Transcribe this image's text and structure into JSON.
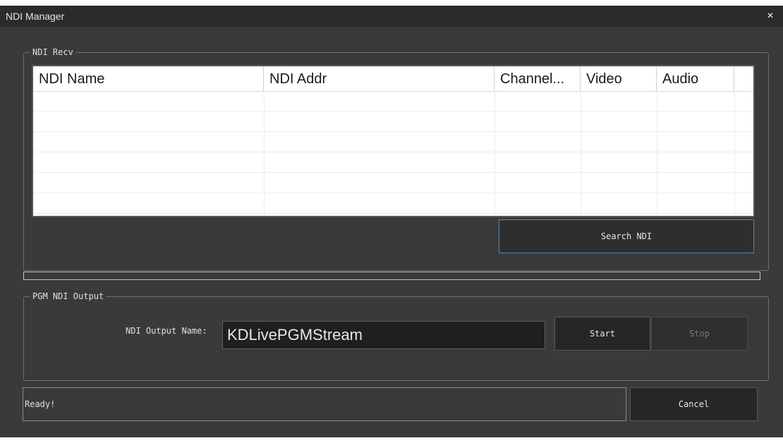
{
  "window": {
    "title": "NDI Manager",
    "close_glyph": "×"
  },
  "recv": {
    "legend": "NDI Recv",
    "columns": [
      "NDI Name",
      "NDI Addr",
      "Channel...",
      "Video",
      "Audio"
    ],
    "rows": [],
    "search_button": "Search NDI"
  },
  "progress": {
    "value": 0
  },
  "output": {
    "legend": "PGM NDI Output",
    "name_label": "NDI Output Name:",
    "name_value": "KDLivePGMStream",
    "start_button": "Start",
    "stop_button": "Stop"
  },
  "status": {
    "text": "Ready!"
  },
  "cancel_button": "Cancel",
  "colors": {
    "background": "#3a3a3a",
    "titlebar": "#2b2b2b",
    "accent": "#3b8fd6"
  }
}
